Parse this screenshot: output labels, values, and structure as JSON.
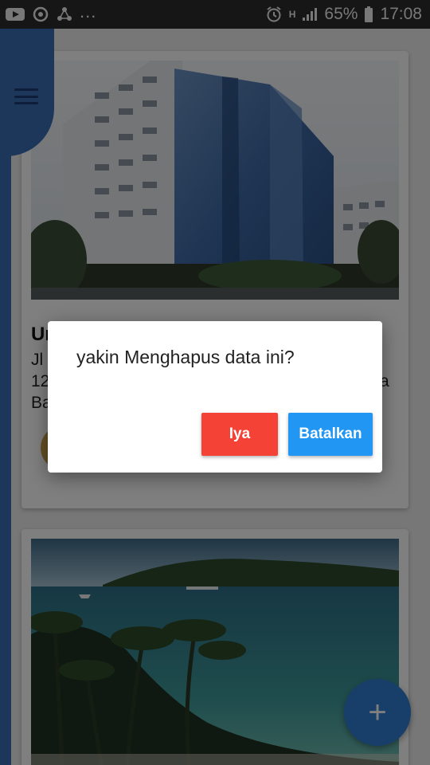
{
  "status_bar": {
    "overflow": "...",
    "battery": "65%",
    "time": "17:08",
    "network": "H"
  },
  "card1": {
    "title": "Ur",
    "address_lines": [
      "Jl",
      "12",
      "Ba"
    ],
    "address_trailing": "a"
  },
  "dialog": {
    "message": "yakin Menghapus data ini?",
    "confirm_label": "Iya",
    "cancel_label": "Batalkan"
  },
  "fab": {
    "label": "+"
  },
  "colors": {
    "drawer": "#3b6fb4",
    "confirm": "#f44336",
    "cancel": "#2196f3",
    "fab": "#2f7fd4"
  },
  "icons": [
    "youtube-icon",
    "sync-icon",
    "share-icon",
    "alarm-icon",
    "signal-icon",
    "battery-icon",
    "menu-icon",
    "add-icon"
  ]
}
